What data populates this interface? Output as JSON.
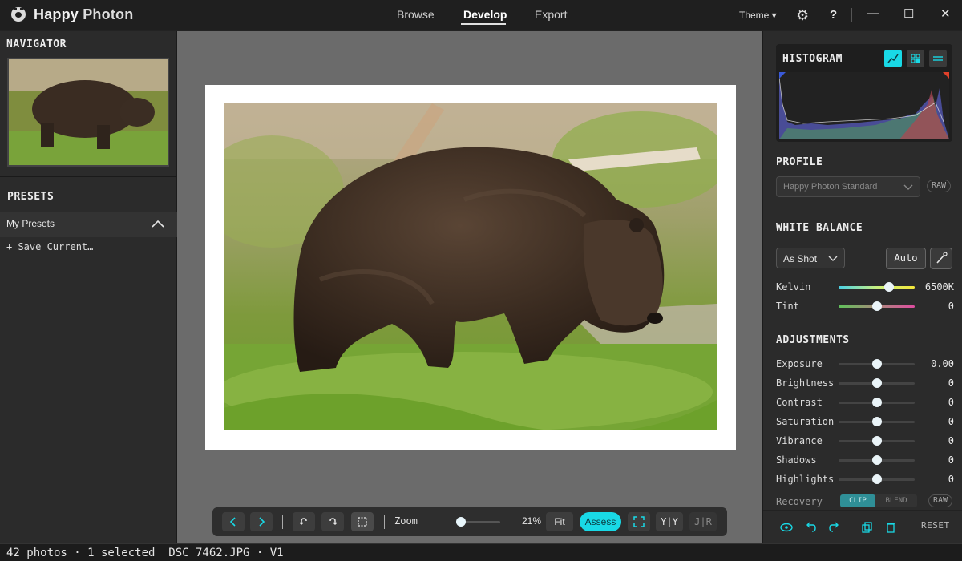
{
  "app": {
    "title_bold": "Happy",
    "title_rest": " Photon"
  },
  "nav": {
    "browse": "Browse",
    "develop": "Develop",
    "export": "Export"
  },
  "header": {
    "theme": "Theme ▾",
    "help": "?",
    "minimize": "—",
    "maximize": "☐",
    "close": "✕"
  },
  "left": {
    "navigator_title": "NAVIGATOR",
    "presets_title": "PRESETS",
    "my_presets": "My Presets",
    "save_current": "+ Save Current…"
  },
  "toolbar": {
    "zoom_label": "Zoom",
    "zoom_value": "21%",
    "zoom_level": 0.21,
    "fit": "Fit",
    "assess": "Assess",
    "yy": "Y|Y",
    "jr": "J|R"
  },
  "right": {
    "histogram_title": "HISTOGRAM",
    "profile_title": "PROFILE",
    "profile_value": "Happy Photon Standard",
    "raw": "RAW",
    "wb_title": "WHITE BALANCE",
    "wb_value": "As Shot",
    "auto": "Auto",
    "kelvin_label": "Kelvin",
    "kelvin_value": "6500K",
    "tint_label": "Tint",
    "tint_value": "0",
    "adjustments_title": "ADJUSTMENTS",
    "adjustments": [
      {
        "label": "Exposure",
        "value": "0.00"
      },
      {
        "label": "Brightness",
        "value": "0"
      },
      {
        "label": "Contrast",
        "value": "0"
      },
      {
        "label": "Saturation",
        "value": "0"
      },
      {
        "label": "Vibrance",
        "value": "0"
      },
      {
        "label": "Shadows",
        "value": "0"
      },
      {
        "label": "Highlights",
        "value": "0"
      }
    ],
    "recovery_label": "Recovery",
    "clip": "CLIP",
    "blend": "BLEND",
    "reset": "RESET"
  },
  "status": {
    "text": "42 photos · 1 selected  DSC_7462.JPG · V1"
  },
  "colors": {
    "accent": "#19d9e6",
    "panel": "#2b2b2b",
    "canvas": "#6b6b6b"
  },
  "icons": [
    "logo-icon",
    "gear-icon",
    "help-icon",
    "chevron-up-icon",
    "prev-icon",
    "next-icon",
    "rotate-left-icon",
    "rotate-right-icon",
    "crop-icon",
    "fullscreen-icon",
    "eye-icon",
    "undo-icon",
    "redo-icon",
    "copy-icon",
    "trash-icon",
    "eyedropper-icon",
    "chevron-down-icon"
  ]
}
